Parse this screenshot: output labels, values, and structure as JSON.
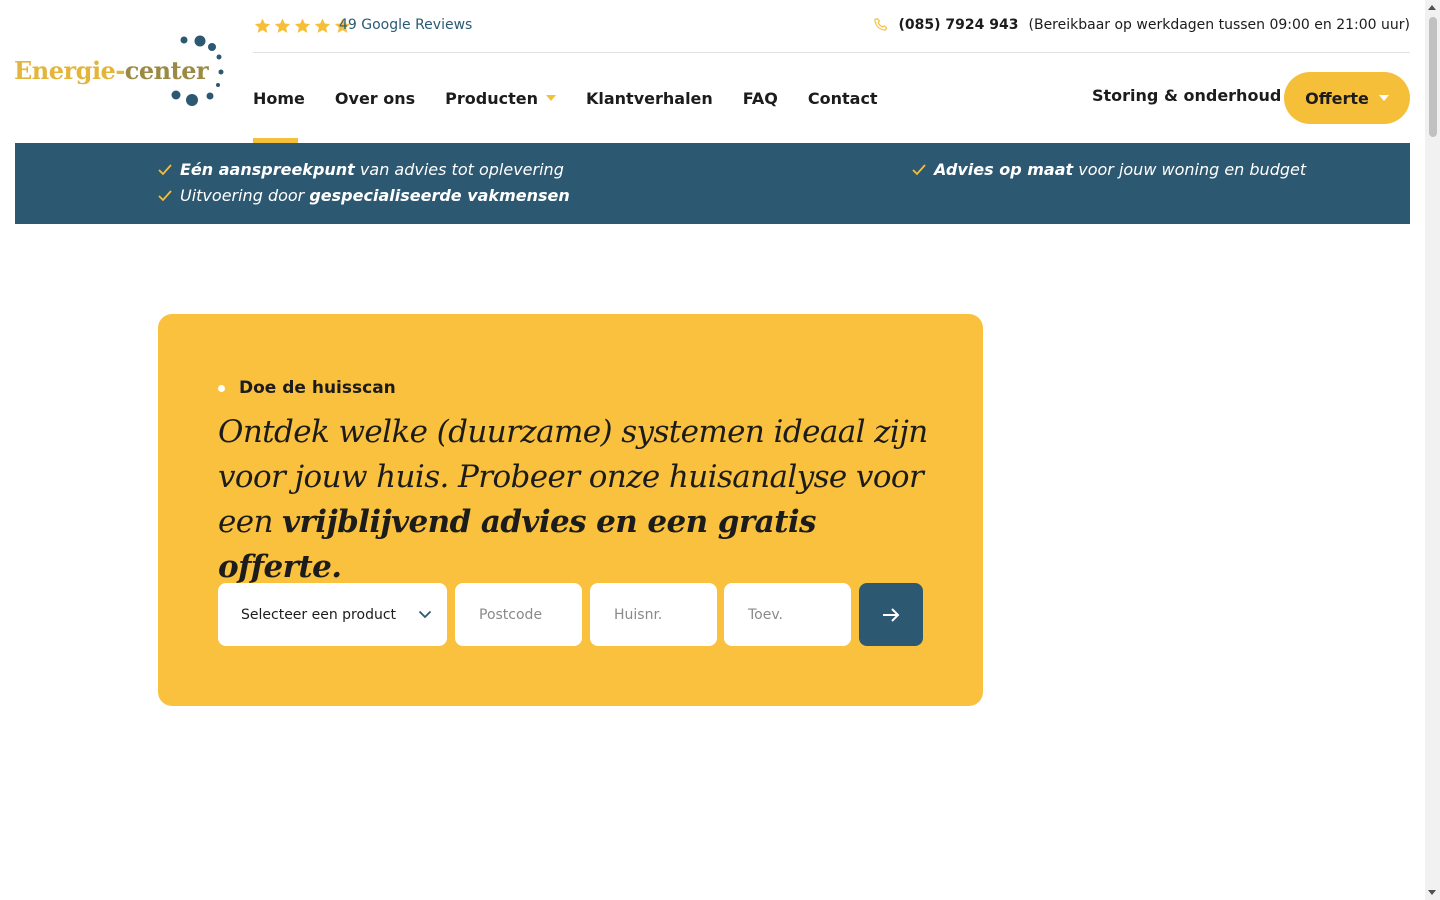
{
  "logo": {
    "text_primary": "Energie-",
    "text_accent": "center"
  },
  "topbar": {
    "rating_stars": 5,
    "reviews_label": "49 Google Reviews",
    "phone_number": "(085) 7924 943",
    "phone_hours": "(Bereikbaar op werkdagen tussen 09:00 en 21:00 uur)"
  },
  "nav": {
    "items": [
      {
        "label": "Home",
        "active": true
      },
      {
        "label": "Over ons"
      },
      {
        "label": "Producten",
        "has_dropdown": true
      },
      {
        "label": "Klantverhalen"
      },
      {
        "label": "FAQ"
      },
      {
        "label": "Contact"
      }
    ],
    "service_label": "Storing & onderhoud",
    "offerte_label": "Offerte"
  },
  "usps": [
    {
      "bold": "Eén aanspreekpunt",
      "rest": " van advies tot oplevering"
    },
    {
      "pre": "Uitvoering door ",
      "bold": "gespecialiseerde vakmensen"
    },
    {
      "bold": "Advies op maat",
      "rest": " voor jouw woning en budget"
    }
  ],
  "huisscan": {
    "eyebrow": "Doe de huisscan",
    "headline_regular": "Ontdek welke (duurzame) systemen ideaal zijn voor jouw huis. Probeer onze huisanalyse voor een ",
    "headline_bold": "vrijblijvend advies en een gratis offerte.",
    "select_value": "Selecteer een product",
    "postcode_placeholder": "Postcode",
    "huisnr_placeholder": "Huisnr.",
    "toev_placeholder": "Toev."
  },
  "colors": {
    "brand_yellow": "#f9c13d",
    "brand_blue": "#2d5871",
    "logo_gold": "#e3b53a"
  }
}
